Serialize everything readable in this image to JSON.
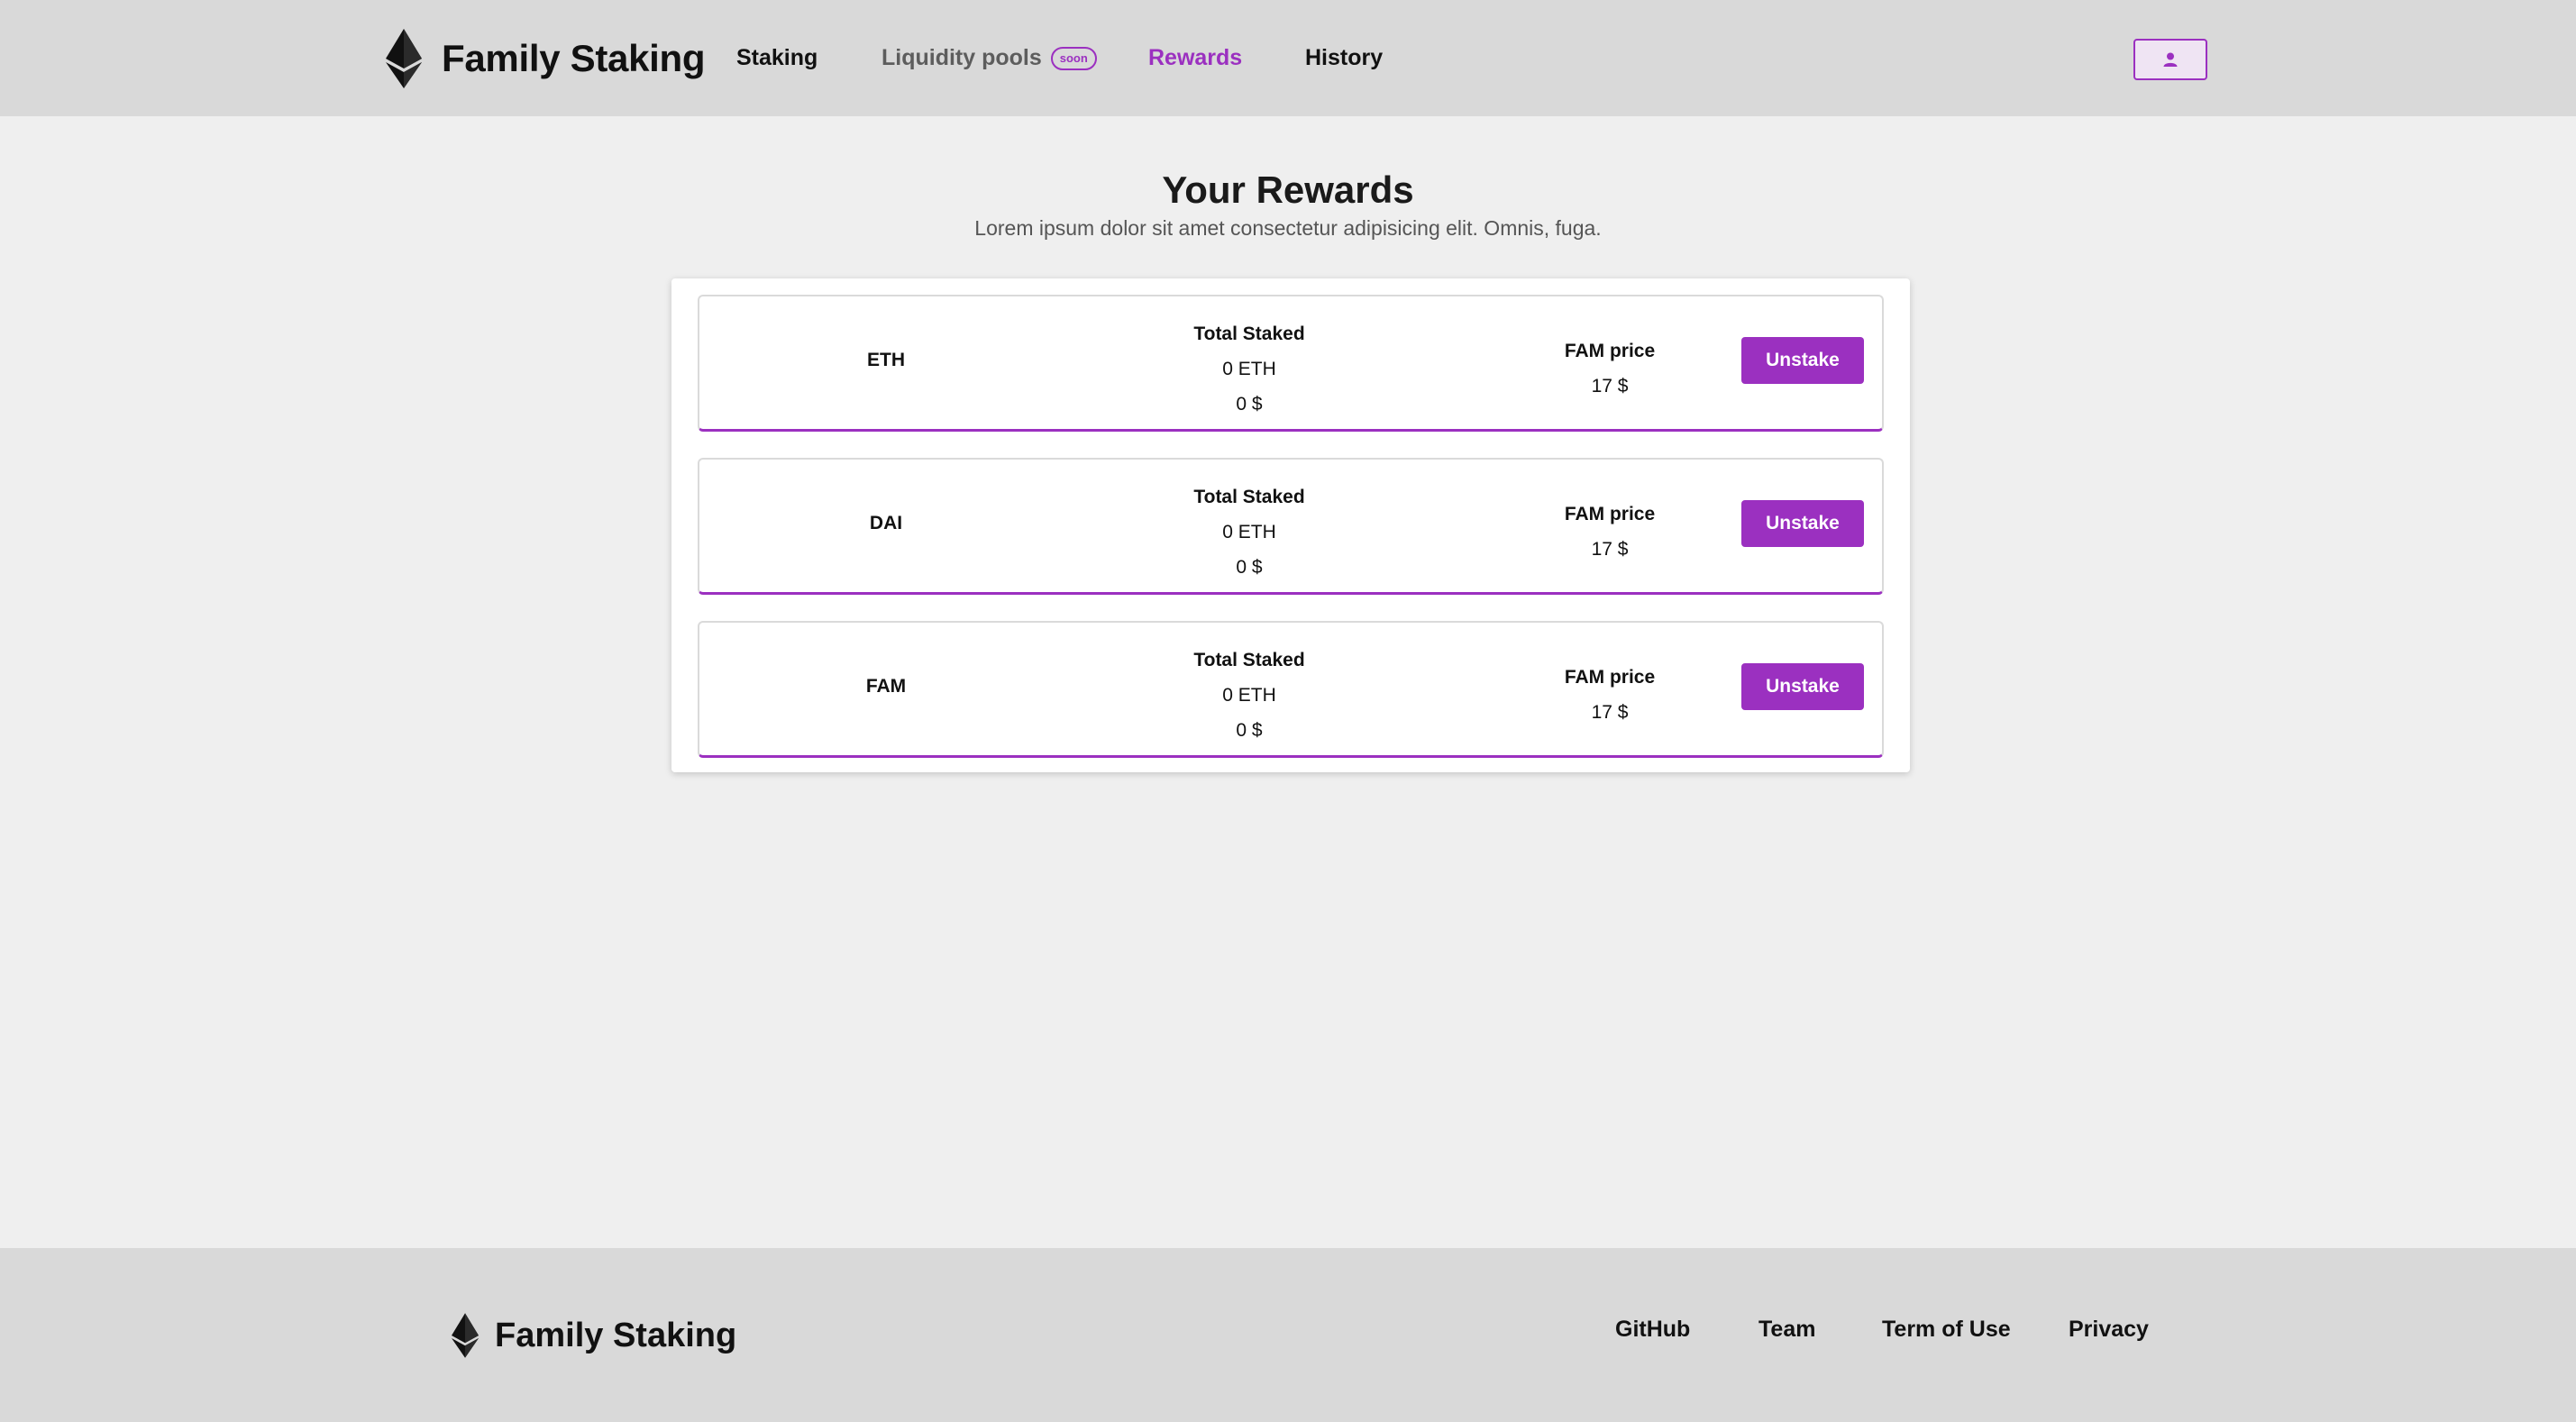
{
  "header": {
    "brand_name": "Family Staking",
    "nav": {
      "staking": "Staking",
      "liquidity": "Liquidity pools",
      "liquidity_badge": "soon",
      "rewards": "Rewards",
      "history": "History"
    },
    "active_nav": "Rewards"
  },
  "main": {
    "title": "Your Rewards",
    "subtitle": "Lorem ipsum dolor sit amet consectetur adipisicing elit. Omnis, fuga.",
    "rewards": [
      {
        "token": "ETH",
        "total_staked_label": "Total Staked",
        "staked_amount": "0 ETH",
        "staked_usd": "0 $",
        "price_label": "FAM price",
        "price_value": "17 $",
        "action_label": "Unstake"
      },
      {
        "token": "DAI",
        "total_staked_label": "Total Staked",
        "staked_amount": "0 ETH",
        "staked_usd": "0 $",
        "price_label": "FAM price",
        "price_value": "17 $",
        "action_label": "Unstake"
      },
      {
        "token": "FAM",
        "total_staked_label": "Total Staked",
        "staked_amount": "0 ETH",
        "staked_usd": "0 $",
        "price_label": "FAM price",
        "price_value": "17 $",
        "action_label": "Unstake"
      }
    ]
  },
  "footer": {
    "brand_name": "Family Staking",
    "links": {
      "github": "GitHub",
      "team": "Team",
      "terms": "Term of Use",
      "privacy": "Privacy"
    }
  },
  "icons": {
    "logo": "ethereum-logo-icon",
    "account": "user-icon"
  },
  "colors": {
    "accent": "#9b30c0",
    "header_bg": "#d9d9d9",
    "page_bg": "#efefef"
  }
}
